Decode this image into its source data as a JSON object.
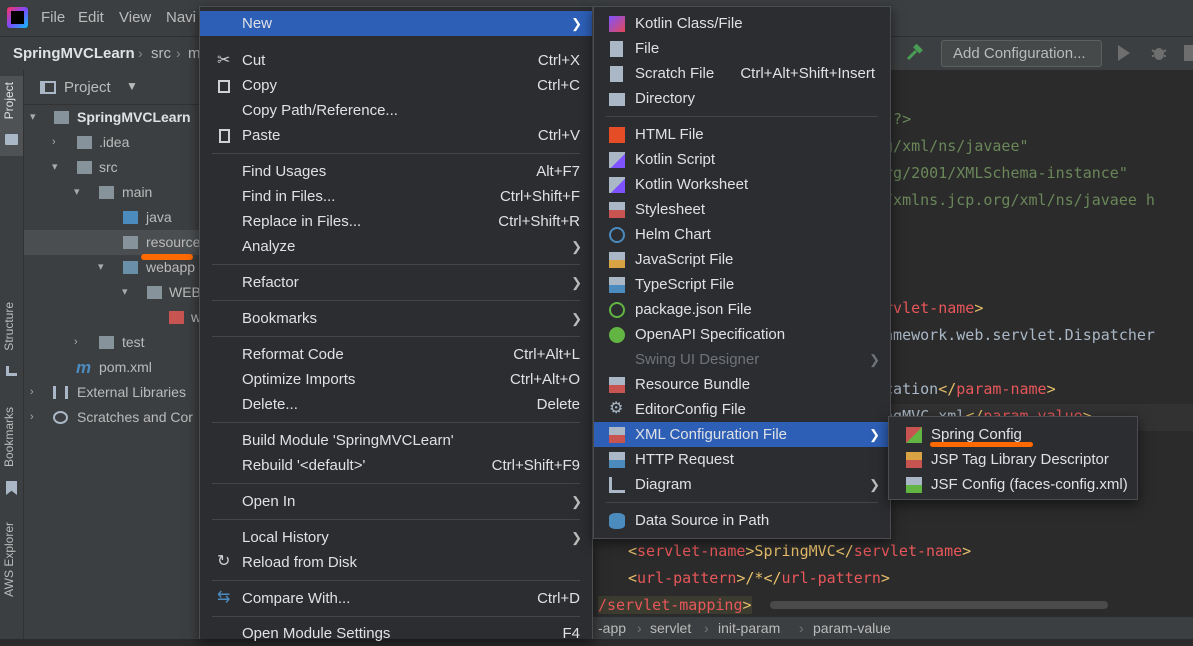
{
  "titlebar": {
    "menus": [
      "File",
      "Edit",
      "View",
      "Navi"
    ],
    "run_config": "Add Configuration..."
  },
  "navbar": {
    "project": "SpringMVCLearn",
    "crumb1": "src",
    "crumb2": "m"
  },
  "tool_windows": {
    "project": "Project",
    "structure": "Structure",
    "bookmarks": "Bookmarks",
    "aws": "AWS Explorer"
  },
  "project_panel": {
    "title": "Project",
    "tree": {
      "root": "SpringMVCLearn",
      "idea": ".idea",
      "src": "src",
      "main": "main",
      "java": "java",
      "resources": "resource",
      "webapp": "webapp",
      "webinf": "WEB",
      "webxml": "w",
      "test": "test",
      "pom": "pom.xml",
      "extlib": "External Libraries",
      "scratches": "Scratches and Cor"
    }
  },
  "editor": {
    "line1": "8\"?>",
    "line2": "rg/xml/ns/javaee\"",
    "line3": "org/2001/XMLSchema-instance\"",
    "line4": "//xmlns.jcp.org/xml/ns/javaee h",
    "line5a": "ervlet-name",
    "line5b": ">",
    "line6": "ramework.web.servlet.Dispatcher",
    "line7a": "ocation",
    "line7b": "</",
    "line7c": "param-name",
    "line7d": ">",
    "line8a": "ingMVC.xml",
    "line8b": "</",
    "line8c": "param-value",
    "line8d": ">",
    "line9a": "<",
    "line9b": "servlet-name",
    "line9c": ">SpringMVC</",
    "line9d": "servlet-name",
    "line9e": ">",
    "line10a": "<",
    "line10b": "url-pattern",
    "line10c": ">/*</",
    "line10d": "url-pattern",
    "line10e": ">",
    "line11a": "/servlet-mapping",
    "line11b": ">"
  },
  "breadcrumb_bottom": [
    "-app",
    "servlet",
    "init-param",
    "param-value"
  ],
  "context_menu": {
    "items": [
      {
        "label": "New",
        "shortcut": "",
        "sub": true
      },
      {
        "label": "Cut",
        "shortcut": "Ctrl+X"
      },
      {
        "label": "Copy",
        "shortcut": "Ctrl+C"
      },
      {
        "label": "Copy Path/Reference...",
        "shortcut": ""
      },
      {
        "label": "Paste",
        "shortcut": "Ctrl+V"
      },
      {
        "label": "Find Usages",
        "shortcut": "Alt+F7"
      },
      {
        "label": "Find in Files...",
        "shortcut": "Ctrl+Shift+F"
      },
      {
        "label": "Replace in Files...",
        "shortcut": "Ctrl+Shift+R"
      },
      {
        "label": "Analyze",
        "shortcut": ""
      },
      {
        "label": "Refactor",
        "shortcut": ""
      },
      {
        "label": "Bookmarks",
        "shortcut": ""
      },
      {
        "label": "Reformat Code",
        "shortcut": "Ctrl+Alt+L"
      },
      {
        "label": "Optimize Imports",
        "shortcut": "Ctrl+Alt+O"
      },
      {
        "label": "Delete...",
        "shortcut": "Delete"
      },
      {
        "label": "Build Module 'SpringMVCLearn'",
        "shortcut": ""
      },
      {
        "label": "Rebuild '<default>'",
        "shortcut": "Ctrl+Shift+F9"
      },
      {
        "label": "Open In",
        "shortcut": ""
      },
      {
        "label": "Local History",
        "shortcut": ""
      },
      {
        "label": "Reload from Disk",
        "shortcut": ""
      },
      {
        "label": "Compare With...",
        "shortcut": "Ctrl+D"
      },
      {
        "label": "Open Module Settings",
        "shortcut": "F4"
      }
    ]
  },
  "new_menu": {
    "items": [
      {
        "label": "Kotlin Class/File",
        "shortcut": ""
      },
      {
        "label": "File",
        "shortcut": ""
      },
      {
        "label": "Scratch File",
        "shortcut": "Ctrl+Alt+Shift+Insert"
      },
      {
        "label": "Directory",
        "shortcut": ""
      },
      {
        "label": "HTML File",
        "shortcut": ""
      },
      {
        "label": "Kotlin Script",
        "shortcut": ""
      },
      {
        "label": "Kotlin Worksheet",
        "shortcut": ""
      },
      {
        "label": "Stylesheet",
        "shortcut": ""
      },
      {
        "label": "Helm Chart",
        "shortcut": ""
      },
      {
        "label": "JavaScript File",
        "shortcut": ""
      },
      {
        "label": "TypeScript File",
        "shortcut": ""
      },
      {
        "label": "package.json File",
        "shortcut": ""
      },
      {
        "label": "OpenAPI Specification",
        "shortcut": ""
      },
      {
        "label": "Swing UI Designer",
        "shortcut": ""
      },
      {
        "label": "Resource Bundle",
        "shortcut": ""
      },
      {
        "label": "EditorConfig File",
        "shortcut": ""
      },
      {
        "label": "XML Configuration File",
        "shortcut": ""
      },
      {
        "label": "HTTP Request",
        "shortcut": ""
      },
      {
        "label": "Diagram",
        "shortcut": ""
      },
      {
        "label": "Data Source in Path",
        "shortcut": ""
      }
    ]
  },
  "xml_menu": {
    "items": [
      {
        "label": "Spring Config"
      },
      {
        "label": "JSP Tag Library Descriptor"
      },
      {
        "label": "JSF Config (faces-config.xml)"
      }
    ]
  },
  "colors": {
    "highlight": "#2e5fb6",
    "annotation": "#ff6a00",
    "menu_bg": "#2b2d30"
  }
}
